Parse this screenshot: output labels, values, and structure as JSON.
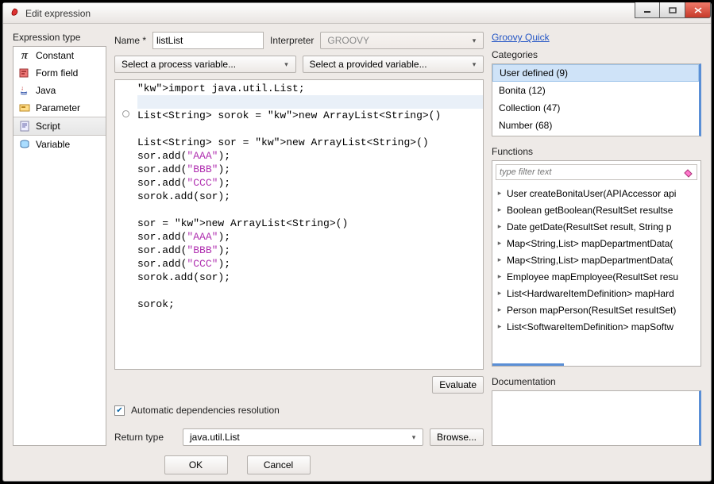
{
  "window": {
    "title": "Edit expression"
  },
  "sidebar": {
    "title": "Expression type",
    "items": [
      {
        "label": "Constant"
      },
      {
        "label": "Form field"
      },
      {
        "label": "Java"
      },
      {
        "label": "Parameter"
      },
      {
        "label": "Script"
      },
      {
        "label": "Variable"
      }
    ]
  },
  "center": {
    "name_label": "Name *",
    "name_value": "listList",
    "interpreter_label": "Interpreter",
    "interpreter_value": "GROOVY",
    "process_var_label": "Select a process variable...",
    "provided_var_label": "Select a provided variable...",
    "code_lines": [
      "import java.util.List;",
      "",
      "List<String> sorok = new ArrayList<String>()",
      "",
      "List<String> sor = new ArrayList<String>()",
      "sor.add(\"AAA\");",
      "sor.add(\"BBB\");",
      "sor.add(\"CCC\");",
      "sorok.add(sor);",
      "",
      "sor = new ArrayList<String>()",
      "sor.add(\"AAA\");",
      "sor.add(\"BBB\");",
      "sor.add(\"CCC\");",
      "sorok.add(sor);",
      "",
      "sorok;"
    ],
    "evaluate_label": "Evaluate",
    "auto_deps_label": "Automatic dependencies resolution",
    "auto_deps_checked": true,
    "return_type_label": "Return type",
    "return_type_value": "java.util.List",
    "browse_label": "Browse..."
  },
  "right": {
    "quick_link": "Groovy Quick",
    "categories_title": "Categories",
    "categories": [
      "User defined (9)",
      "Bonita (12)",
      "Collection (47)",
      "Number (68)"
    ],
    "functions_title": "Functions",
    "filter_placeholder": "type filter text",
    "functions": [
      "User createBonitaUser(APIAccessor api",
      "Boolean getBoolean(ResultSet resultse",
      "Date getDate(ResultSet result, String p",
      "Map<String,List> mapDepartmentData(",
      "Map<String,List> mapDepartmentData(",
      "Employee mapEmployee(ResultSet resu",
      "List<HardwareItemDefinition> mapHard",
      "Person mapPerson(ResultSet resultSet)",
      "List<SoftwareItemDefinition> mapSoftw"
    ],
    "documentation_title": "Documentation"
  },
  "buttons": {
    "ok": "OK",
    "cancel": "Cancel"
  }
}
